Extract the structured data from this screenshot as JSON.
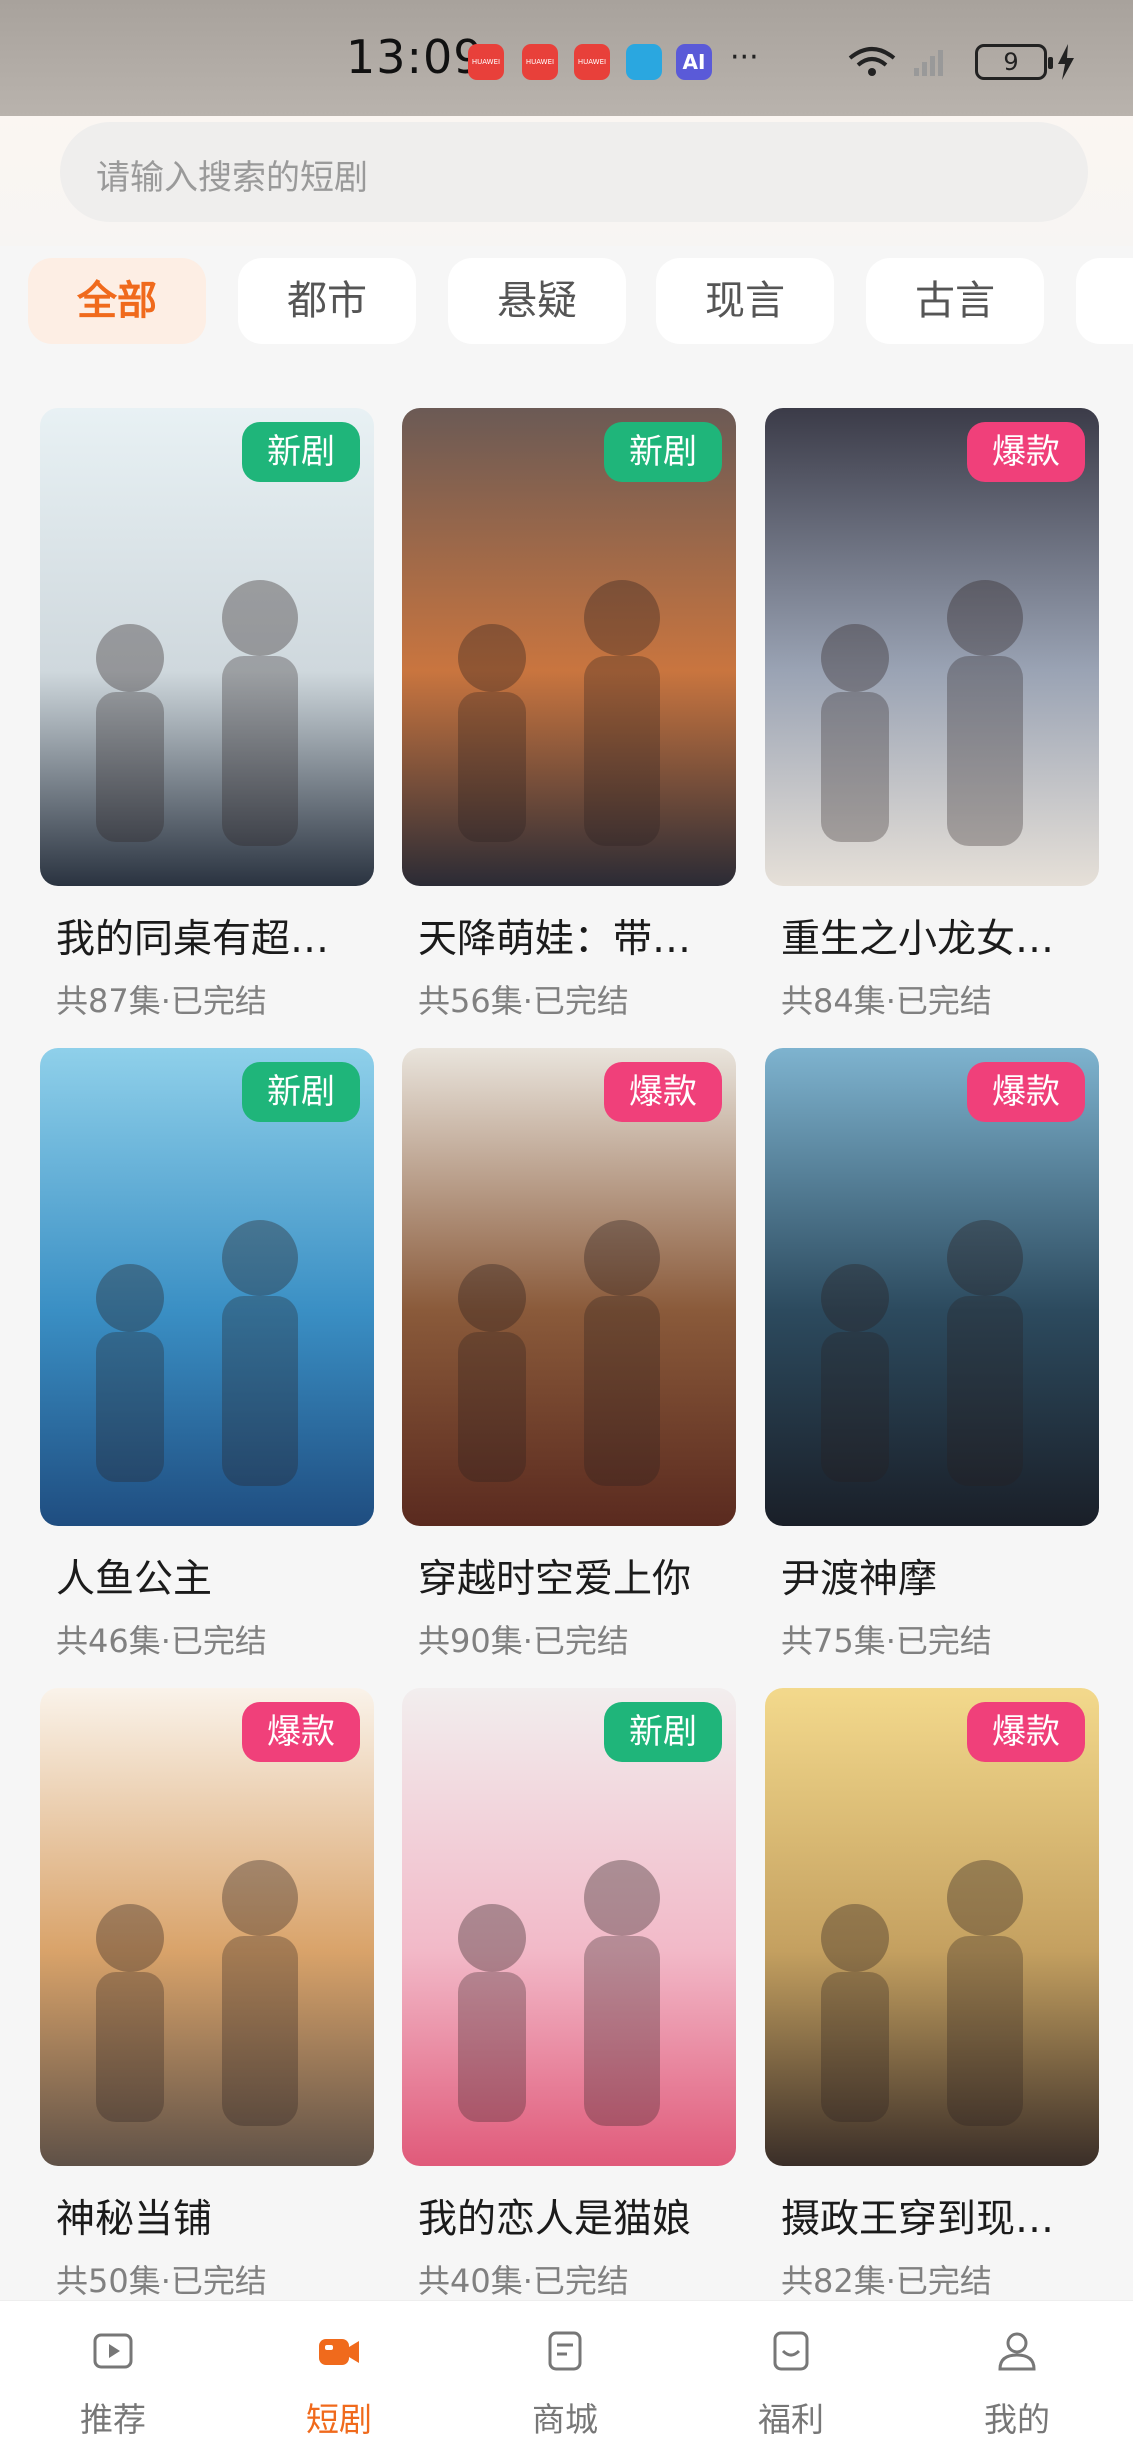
{
  "status_bar": {
    "time": "13:09",
    "app_icons": [
      "HUAWEI",
      "HUAWEI",
      "HUAWEI"
    ],
    "battery": "9",
    "more": "···"
  },
  "search": {
    "placeholder": "请输入搜索的短剧"
  },
  "categories": [
    {
      "label": "全部",
      "active": true
    },
    {
      "label": "都市",
      "active": false
    },
    {
      "label": "悬疑",
      "active": false
    },
    {
      "label": "现言",
      "active": false
    },
    {
      "label": "古言",
      "active": false
    }
  ],
  "dramas": [
    {
      "title": "我的同桌有超…",
      "meta": "共87集·已完结",
      "badge": "新剧",
      "badge_type": "new",
      "colors": [
        "#e8f1f4",
        "#cfd8dd",
        "#2a3340"
      ]
    },
    {
      "title": "天降萌娃：带…",
      "meta": "共56集·已完结",
      "badge": "新剧",
      "badge_type": "new",
      "colors": [
        "#6b5a55",
        "#c9753f",
        "#2b2b35"
      ]
    },
    {
      "title": "重生之小龙女…",
      "meta": "共84集·已完结",
      "badge": "爆款",
      "badge_type": "hot",
      "colors": [
        "#3b3b48",
        "#9aa3b4",
        "#e6e0d8"
      ]
    },
    {
      "title": "人鱼公主",
      "meta": "共46集·已完结",
      "badge": "新剧",
      "badge_type": "new",
      "colors": [
        "#8fd0ea",
        "#3a8fc4",
        "#1f4d80"
      ]
    },
    {
      "title": "穿越时空爱上你",
      "meta": "共90集·已完结",
      "badge": "爆款",
      "badge_type": "hot",
      "colors": [
        "#e9e4dc",
        "#8a5a3a",
        "#5a2a1f"
      ]
    },
    {
      "title": "尹渡神摩",
      "meta": "共75集·已完结",
      "badge": "爆款",
      "badge_type": "hot",
      "colors": [
        "#7eb3cf",
        "#2c4a5e",
        "#1a1f28"
      ]
    },
    {
      "title": "神秘当铺",
      "meta": "共50集·已完结",
      "badge": "爆款",
      "badge_type": "hot",
      "colors": [
        "#faf3ea",
        "#d9a36a",
        "#5f5147"
      ]
    },
    {
      "title": "我的恋人是猫娘",
      "meta": "共40集·已完结",
      "badge": "新剧",
      "badge_type": "new",
      "colors": [
        "#f2eeee",
        "#f2b9c8",
        "#e05a7a"
      ]
    },
    {
      "title": "摄政王穿到现…",
      "meta": "共82集·已完结",
      "badge": "爆款",
      "badge_type": "hot",
      "colors": [
        "#f3d98c",
        "#c4a060",
        "#3a2e28"
      ]
    }
  ],
  "nav": [
    {
      "label": "推荐",
      "icon": "play-square-icon",
      "active": false
    },
    {
      "label": "短剧",
      "icon": "video-camera-icon",
      "active": true
    },
    {
      "label": "商城",
      "icon": "document-icon",
      "active": false
    },
    {
      "label": "福利",
      "icon": "gift-box-icon",
      "active": false
    },
    {
      "label": "我的",
      "icon": "user-icon",
      "active": false
    }
  ],
  "accent_color": "#f06a1c"
}
